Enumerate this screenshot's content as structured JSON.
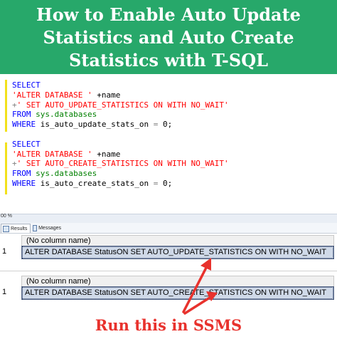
{
  "banner": {
    "line1": "How to Enable Auto Update",
    "line2": "Statistics and Auto Create",
    "line3": "Statistics with T-SQL",
    "background": "#27a86a"
  },
  "editor": {
    "block1": {
      "select": "SELECT",
      "alter_str": "'ALTER DATABASE '",
      "plus_name": " +name",
      "plus": "+",
      "set_str": "' SET AUTO_UPDATE_STATISTICS ON WITH NO_WAIT'",
      "from": "FROM",
      "sysdb": " sys.databases",
      "where": "WHERE",
      "cond_col": " is_auto_update_stats_on ",
      "cond_op": "=",
      "cond_val": " 0;"
    },
    "block2": {
      "select": "SELECT",
      "alter_str": "'ALTER DATABASE '",
      "plus_name": " +name",
      "plus": "+",
      "set_str": "' SET AUTO_CREATE_STATISTICS ON WITH NO_WAIT'",
      "from": "FROM",
      "sysdb": " sys.databases",
      "where": "WHERE",
      "cond_col": " is_auto_create_stats_on ",
      "cond_op": "=",
      "cond_val": " 0;"
    }
  },
  "status": {
    "zoom": "00 %"
  },
  "tabs": {
    "results": "Results",
    "messages": "Messages"
  },
  "results": [
    {
      "header": "(No column name)",
      "row_number": "1",
      "value": "ALTER DATABASE StatusON SET AUTO_UPDATE_STATISTICS ON WITH NO_WAIT"
    },
    {
      "header": "(No column name)",
      "row_number": "1",
      "value": "ALTER DATABASE StatusON SET AUTO_CREATE_STATISTICS ON WITH NO_WAIT"
    }
  ],
  "annotation": {
    "text": "Run this in SSMS",
    "color": "#e8322d"
  }
}
